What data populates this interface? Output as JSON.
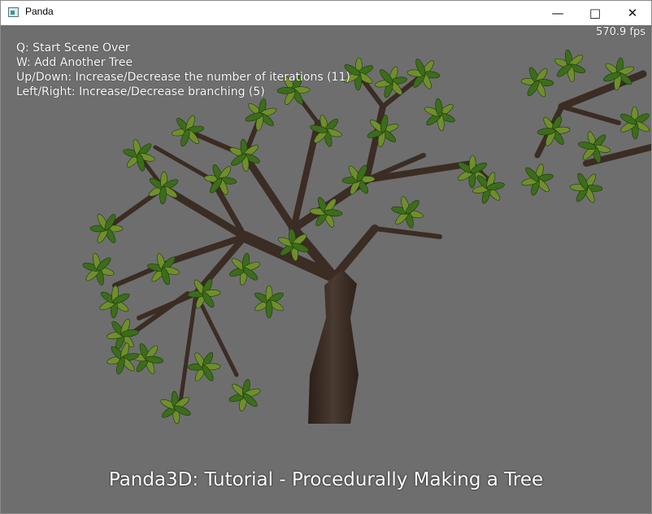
{
  "window": {
    "title": "Panda"
  },
  "hud": {
    "fps": "570.9 fps",
    "instructions": [
      "Q: Start Scene Over",
      "W: Add Another Tree",
      "Up/Down: Increase/Decrease the number of iterations (11)",
      "Left/Right: Increase/Decrease branching (5)"
    ],
    "caption": "Panda3D: Tutorial - Procedurally Making a Tree"
  },
  "colors": {
    "background": "#6e6e6e",
    "bark": "#3b2c24",
    "leaf": "#3b6d1a"
  }
}
